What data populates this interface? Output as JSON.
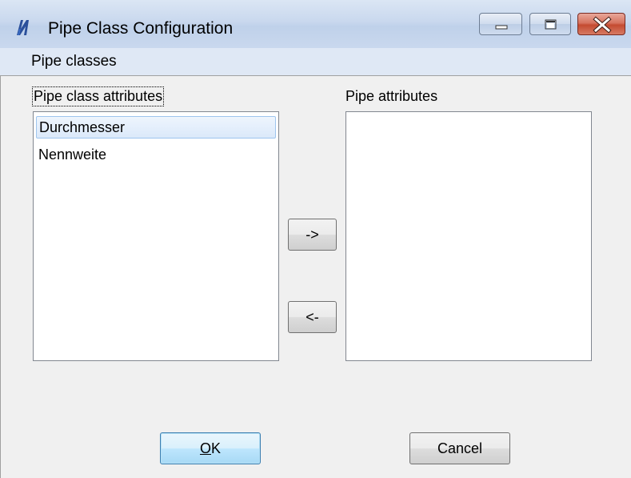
{
  "window": {
    "title": "Pipe Class Configuration"
  },
  "menu": {
    "items": [
      "Pipe classes"
    ]
  },
  "left_panel": {
    "label": "Pipe class attributes",
    "items": [
      {
        "label": "Durchmesser",
        "selected": true
      },
      {
        "label": "Nennweite",
        "selected": false
      }
    ]
  },
  "right_panel": {
    "label": "Pipe attributes",
    "items": []
  },
  "transfer": {
    "add_label": "->",
    "remove_label": "<-"
  },
  "buttons": {
    "ok_mnemonic": "O",
    "ok_rest": "K",
    "cancel_label": "Cancel"
  },
  "icons": {
    "app": "app-logo-icon",
    "minimize": "minimize-icon",
    "maximize": "maximize-icon",
    "close": "close-icon"
  },
  "colors": {
    "close_button": "#c44b31",
    "selection": "#dbe9fa",
    "default_button_border": "#3c7fb1"
  }
}
